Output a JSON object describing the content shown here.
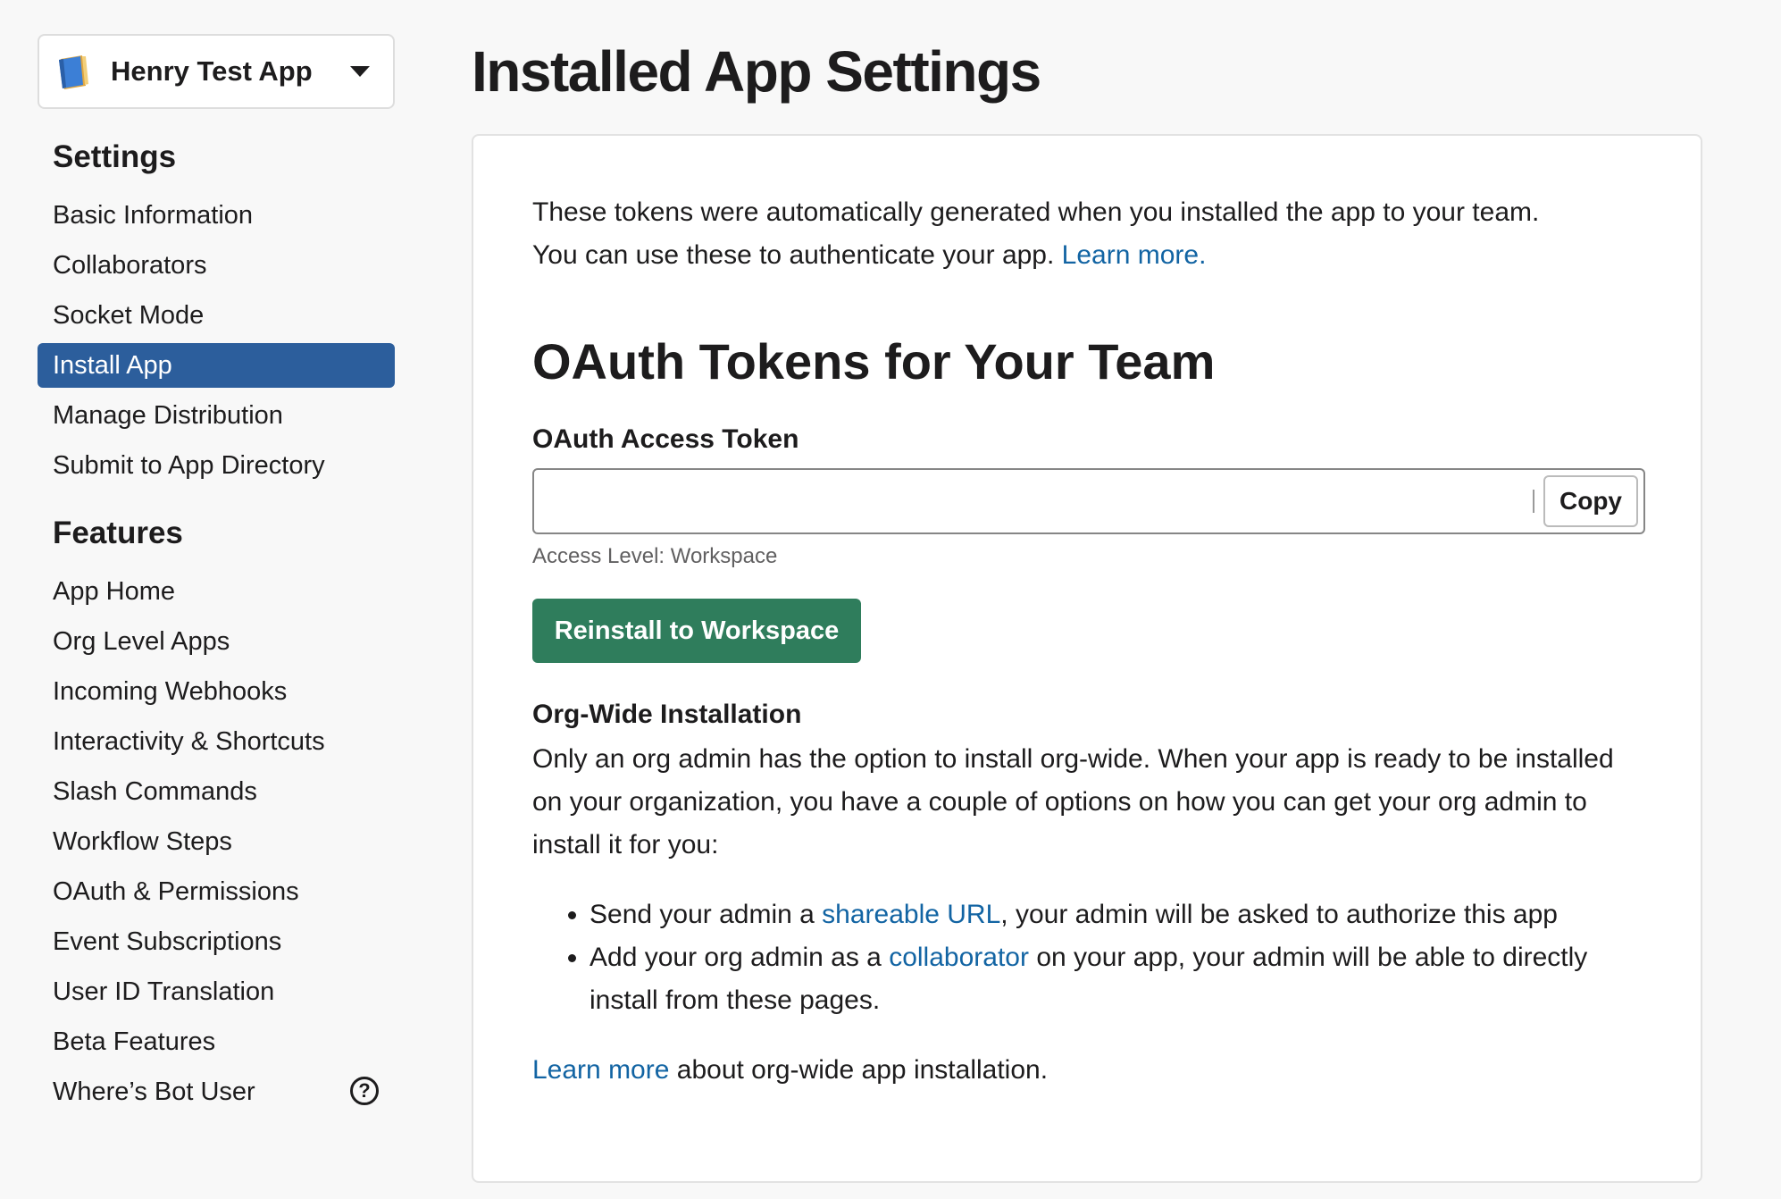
{
  "sidebar": {
    "app_name": "Henry Test App",
    "app_icon": "book-icon",
    "settings_title": "Settings",
    "settings_items": [
      {
        "label": "Basic Information",
        "active": false
      },
      {
        "label": "Collaborators",
        "active": false
      },
      {
        "label": "Socket Mode",
        "active": false
      },
      {
        "label": "Install App",
        "active": true
      },
      {
        "label": "Manage Distribution",
        "active": false
      },
      {
        "label": "Submit to App Directory",
        "active": false
      }
    ],
    "features_title": "Features",
    "features_items": [
      {
        "label": "App Home"
      },
      {
        "label": "Org Level Apps"
      },
      {
        "label": "Incoming Webhooks"
      },
      {
        "label": "Interactivity & Shortcuts"
      },
      {
        "label": "Slash Commands"
      },
      {
        "label": "Workflow Steps"
      },
      {
        "label": "OAuth & Permissions"
      },
      {
        "label": "Event Subscriptions"
      },
      {
        "label": "User ID Translation"
      },
      {
        "label": "Beta Features"
      },
      {
        "label": "Where’s Bot User",
        "icon": "help-circle-icon",
        "icon_glyph": "?"
      }
    ]
  },
  "main": {
    "page_title": "Installed App Settings",
    "intro_line1": "These tokens were automatically generated when you installed the app to your team.",
    "intro_line2": "You can use these to authenticate your app.",
    "intro_link": "Learn more.",
    "oauth_heading": "OAuth Tokens for Your Team",
    "token_label": "OAuth Access Token",
    "token_value": "",
    "copy_label": "Copy",
    "access_level": "Access Level: Workspace",
    "reinstall_label": "Reinstall to Workspace",
    "org_heading": "Org-Wide Installation",
    "org_body": "Only an org admin has the option to install org-wide. When your app is ready to be installed on your organization, you have a couple of options on how you can get your org admin to install it for you:",
    "bullet1_pre": "Send your admin a",
    "bullet1_link": "shareable URL",
    "bullet1_post": ", your admin will be asked to authorize this app",
    "bullet2_pre": "Add your org admin as a",
    "bullet2_link": "collaborator",
    "bullet2_post": "on your app, your admin will be able to directly install from these pages.",
    "footer_link": "Learn more",
    "footer_text": "about org-wide app installation."
  },
  "colors": {
    "active_nav": "#2c5e9c",
    "primary_button": "#2f7d5c",
    "link": "#1264a3",
    "background": "#f8f8f8"
  }
}
